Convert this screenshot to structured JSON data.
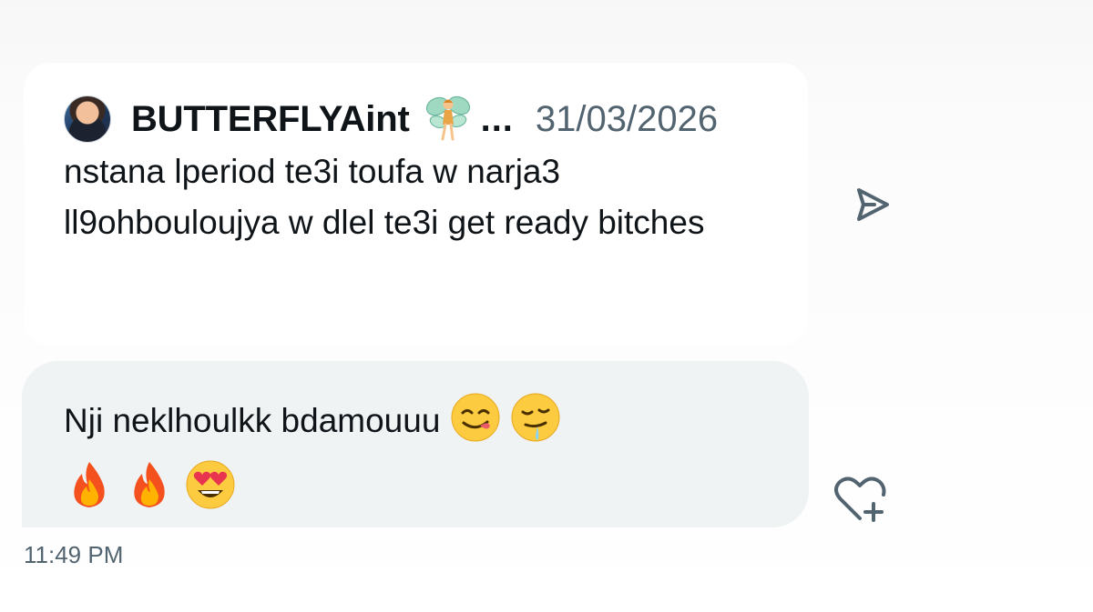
{
  "quote": {
    "author": "BUTTERFLYAint",
    "author_emoji_icon": "fairy-icon",
    "truncation": "...",
    "date": "31/03/2026",
    "text": "nstana lperiod te3i toufa w narja3 ll9ohbouloujya w dlel te3i get ready bitches"
  },
  "reply": {
    "text": "Nji neklhoulkk bdamouuu",
    "emojis": [
      "😋",
      "🤤",
      "🔥",
      "🔥",
      "😍"
    ],
    "bubble_color": "#eff3f4"
  },
  "message_time": "11:49 PM",
  "icons": {
    "share": "share-arrow-icon",
    "react": "heart-plus-icon",
    "avatar": "avatar"
  },
  "colors": {
    "text_primary": "#0f1419",
    "text_secondary": "#536471",
    "icon_color": "#536471"
  }
}
